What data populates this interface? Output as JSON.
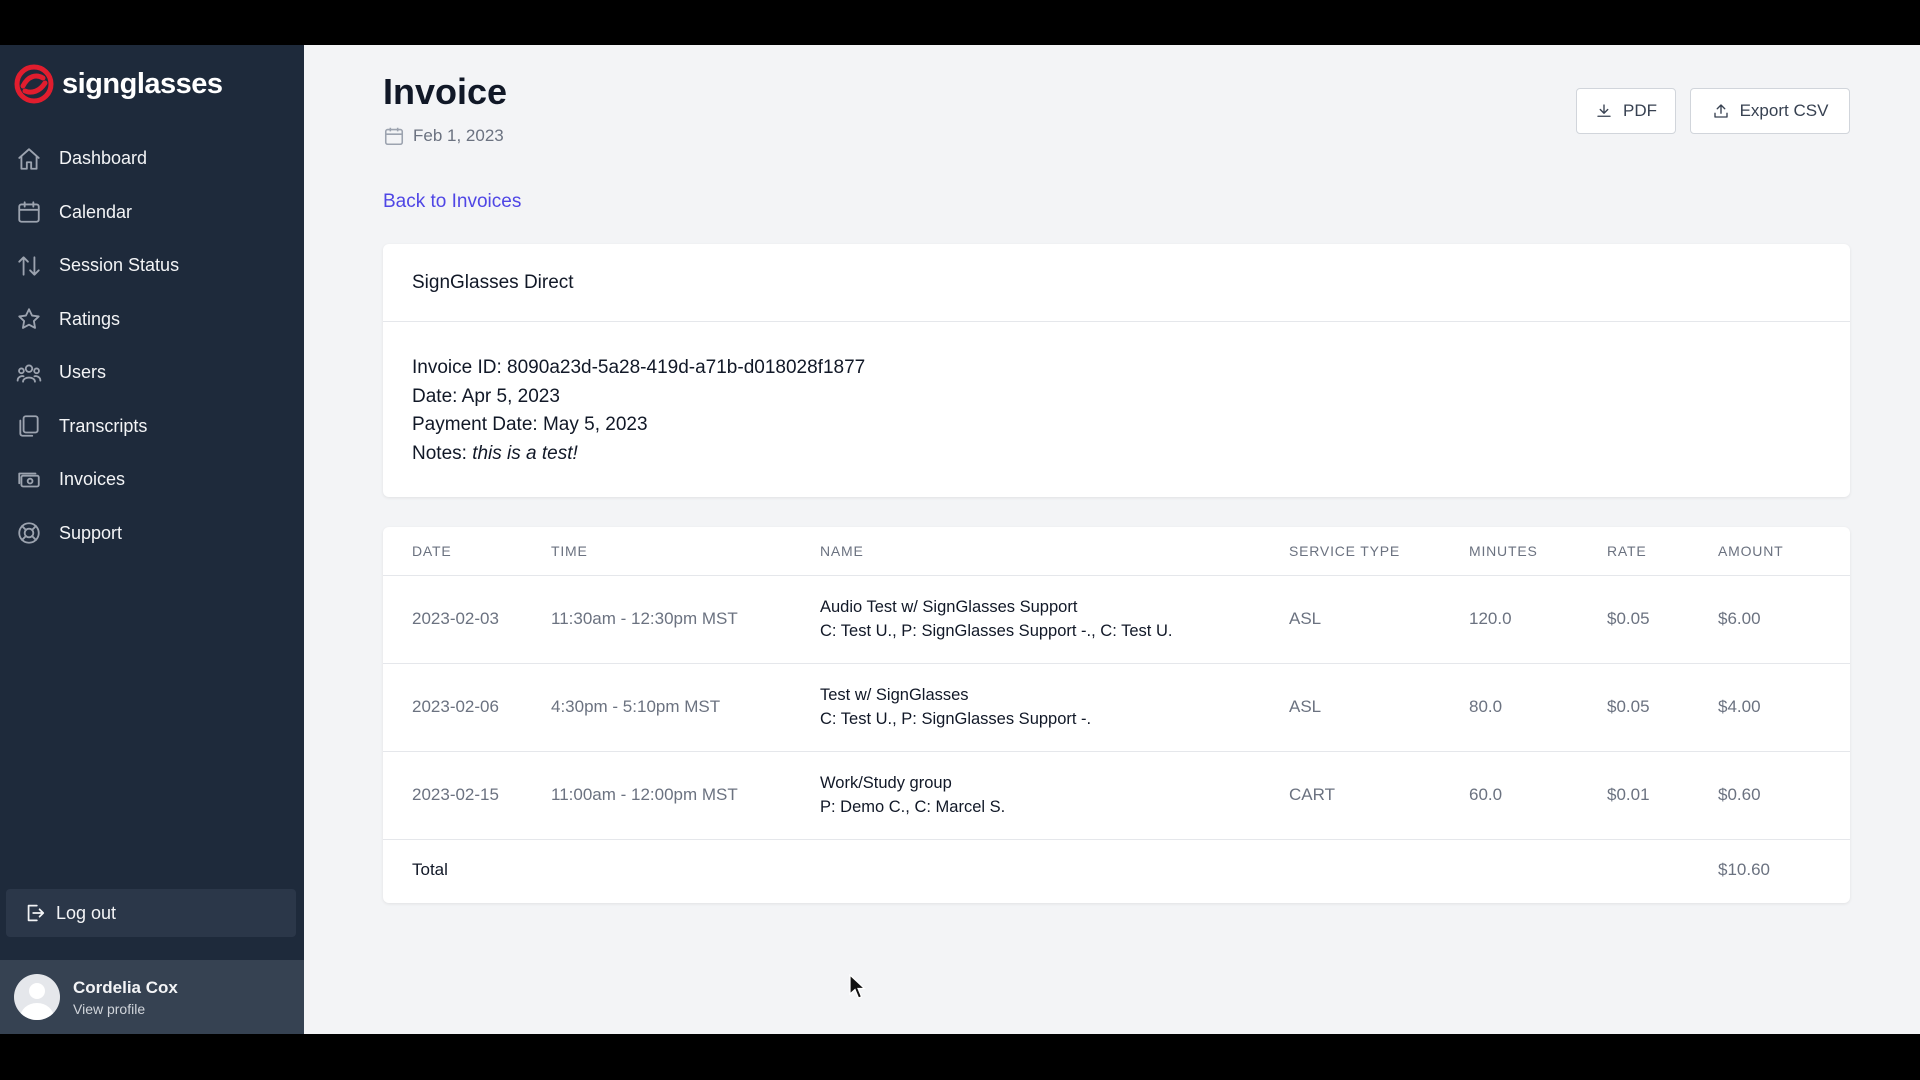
{
  "brand": {
    "name": "signglasses",
    "logo_color": "#e11d2e"
  },
  "sidebar": {
    "items": [
      {
        "label": "Dashboard",
        "icon": "home-icon"
      },
      {
        "label": "Calendar",
        "icon": "calendar-icon"
      },
      {
        "label": "Session Status",
        "icon": "arrows-up-down-icon"
      },
      {
        "label": "Ratings",
        "icon": "star-icon"
      },
      {
        "label": "Users",
        "icon": "users-icon"
      },
      {
        "label": "Transcripts",
        "icon": "documents-icon"
      },
      {
        "label": "Invoices",
        "icon": "cash-icon"
      },
      {
        "label": "Support",
        "icon": "lifebuoy-icon"
      }
    ],
    "logout_label": "Log out",
    "profile": {
      "name": "Cordelia Cox",
      "link": "View profile"
    }
  },
  "header": {
    "title": "Invoice",
    "date": "Feb 1, 2023",
    "pdf_label": "PDF",
    "csv_label": "Export CSV",
    "back_link": "Back to Invoices"
  },
  "invoice": {
    "company": "SignGlasses Direct",
    "id_label": "Invoice ID:",
    "id_value": "8090a23d-5a28-419d-a71b-d018028f1877",
    "date_label": "Date:",
    "date_value": "Apr 5, 2023",
    "payment_label": "Payment Date:",
    "payment_value": "May 5, 2023",
    "notes_label": "Notes:",
    "notes_value": "this is a test!"
  },
  "table": {
    "columns": [
      "DATE",
      "TIME",
      "NAME",
      "SERVICE TYPE",
      "MINUTES",
      "RATE",
      "AMOUNT"
    ],
    "rows": [
      {
        "date": "2023-02-03",
        "time": "11:30am - 12:30pm MST",
        "name": "Audio Test w/ SignGlasses Support",
        "participants": "C: Test U., P: SignGlasses Support -., C: Test U.",
        "service": "ASL",
        "minutes": "120.0",
        "rate": "$0.05",
        "amount": "$6.00"
      },
      {
        "date": "2023-02-06",
        "time": "4:30pm - 5:10pm MST",
        "name": "Test w/ SignGlasses",
        "participants": "C: Test U., P: SignGlasses Support -.",
        "service": "ASL",
        "minutes": "80.0",
        "rate": "$0.05",
        "amount": "$4.00"
      },
      {
        "date": "2023-02-15",
        "time": "11:00am - 12:00pm MST",
        "name": "Work/Study group",
        "participants": "P: Demo C., C: Marcel S.",
        "service": "CART",
        "minutes": "60.0",
        "rate": "$0.01",
        "amount": "$0.60"
      }
    ],
    "total_label": "Total",
    "total_value": "$10.60"
  }
}
